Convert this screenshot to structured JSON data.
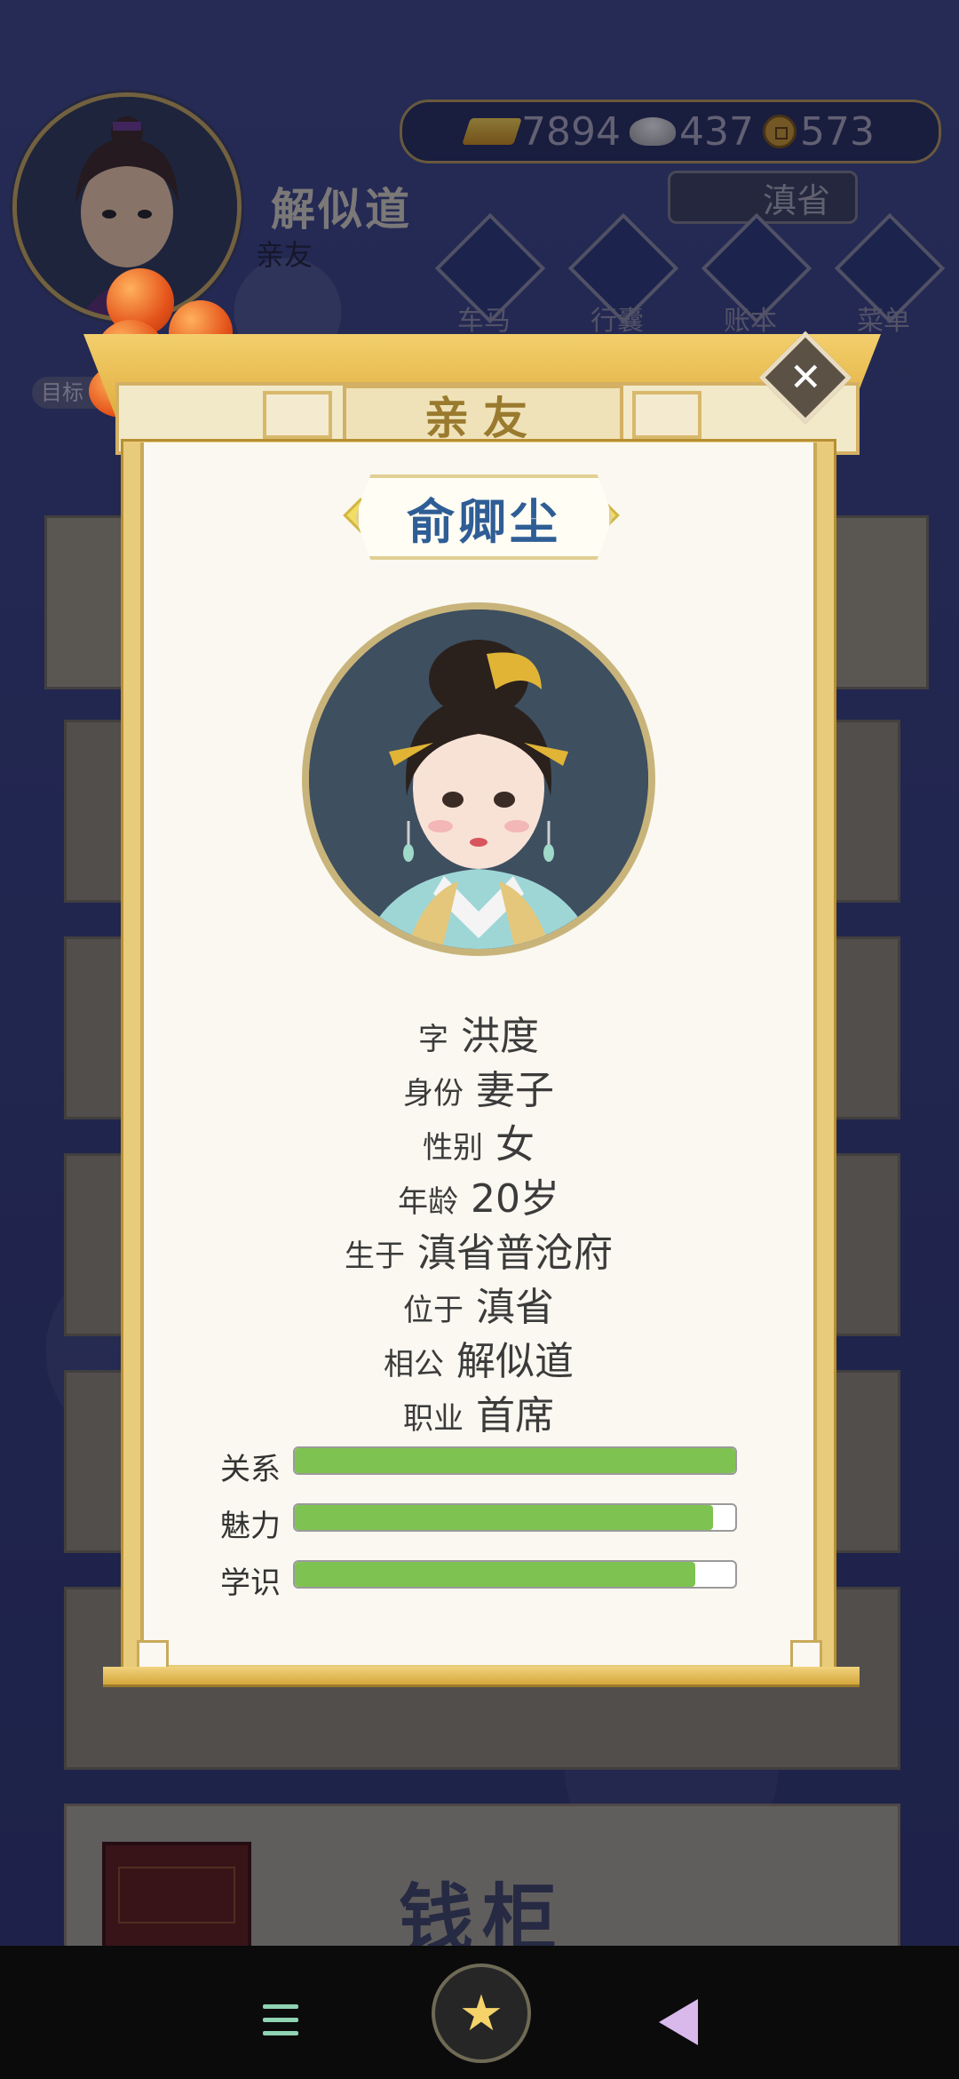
{
  "hud": {
    "player_name": "解似道",
    "player_sub": "亲友",
    "gold": "7894",
    "silver": "437",
    "coins": "573",
    "location": "滇省",
    "side_label": "目标"
  },
  "nav_buttons": [
    {
      "label": "车马"
    },
    {
      "label": "行囊"
    },
    {
      "label": "账本"
    },
    {
      "label": "菜单"
    }
  ],
  "background": {
    "bottom_card_label": "钱柜"
  },
  "modal": {
    "title": "亲友",
    "close_symbol": "✕",
    "character_name": "俞卿尘",
    "info": [
      {
        "key": "字",
        "value": "洪度"
      },
      {
        "key": "身份",
        "value": "妻子"
      },
      {
        "key": "性别",
        "value": "女"
      },
      {
        "key": "年龄",
        "value": "20岁"
      },
      {
        "key": "生于",
        "value": "滇省普沧府"
      },
      {
        "key": "位于",
        "value": "滇省"
      },
      {
        "key": "相公",
        "value": "解似道"
      },
      {
        "key": "职业",
        "value": "首席"
      }
    ],
    "stats": [
      {
        "label": "关系",
        "fraction": 1.0
      },
      {
        "label": "魅力",
        "fraction": 0.95
      },
      {
        "label": "学识",
        "fraction": 0.91
      }
    ]
  },
  "colors": {
    "accent_gold": "#e0ae3e",
    "name_blue": "#2f5e96",
    "bar_green": "#7ec351"
  }
}
